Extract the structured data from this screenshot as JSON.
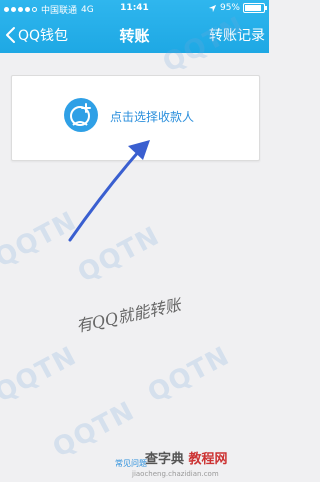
{
  "status_bar": {
    "carrier": "中国联通",
    "network": "4G",
    "time": "11:41",
    "battery": "95%"
  },
  "nav": {
    "back_label": "QQ钱包",
    "title": "转账",
    "right_label": "转账记录"
  },
  "recipient_card": {
    "label": "点击选择收款人",
    "icon": "user-add-icon"
  },
  "watermark": {
    "text": "QQTN"
  },
  "slogan": "有QQ就能转账",
  "footer": {
    "faq_link": "常见问题"
  },
  "site_watermark": {
    "brand_a": "查字典",
    "brand_b": "教程网",
    "url": "jiaocheng.chazidian.com"
  },
  "colors": {
    "header": "#1ea8e4",
    "accent": "#2b8fdc",
    "background": "#f0f0f2"
  }
}
